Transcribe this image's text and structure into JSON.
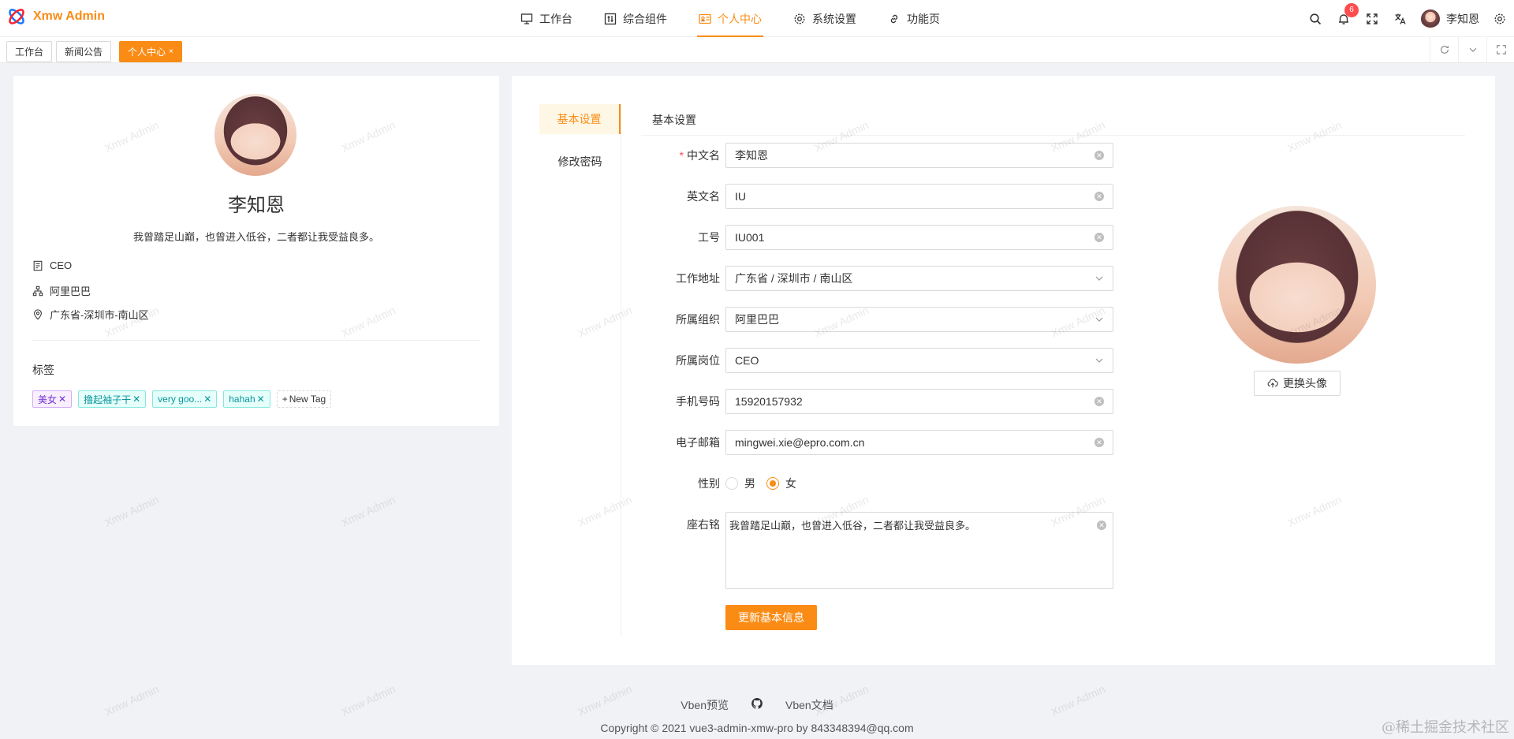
{
  "app": {
    "title": "Xmw Admin"
  },
  "topnav": [
    {
      "label": "工作台",
      "icon": "monitor-icon"
    },
    {
      "label": "综合组件",
      "icon": "component-icon"
    },
    {
      "label": "个人中心",
      "icon": "id-card-icon",
      "active": true
    },
    {
      "label": "系统设置",
      "icon": "gear-icon"
    },
    {
      "label": "功能页",
      "icon": "link-icon"
    }
  ],
  "header": {
    "notification_count": "6",
    "username": "李知恩"
  },
  "tabs": [
    {
      "label": "工作台"
    },
    {
      "label": "新闻公告"
    },
    {
      "label": "个人中心",
      "active": true,
      "close": "×"
    }
  ],
  "watermark": "Xmw Admin",
  "profile": {
    "name": "李知恩",
    "motto": "我曾踏足山巅，也曾进入低谷，二者都让我受益良多。",
    "position": "CEO",
    "organization": "阿里巴巴",
    "location": "广东省-深圳市-南山区",
    "tags_title": "标签",
    "tags": [
      "美女",
      "撸起袖子干",
      "very goo...",
      "hahah"
    ],
    "new_tag": "New Tag"
  },
  "settings": {
    "menu": [
      "基本设置",
      "修改密码"
    ],
    "section_title": "基本设置",
    "fields": {
      "cn_name": {
        "label": "中文名",
        "value": "李知恩",
        "required": true
      },
      "en_name": {
        "label": "英文名",
        "value": "IU"
      },
      "job_no": {
        "label": "工号",
        "value": "IU001"
      },
      "address": {
        "label": "工作地址",
        "value": "广东省 / 深圳市 / 南山区"
      },
      "org": {
        "label": "所属组织",
        "value": "阿里巴巴"
      },
      "post": {
        "label": "所属岗位",
        "value": "CEO"
      },
      "phone": {
        "label": "手机号码",
        "value": "15920157932"
      },
      "email": {
        "label": "电子邮箱",
        "value": "mingwei.xie@epro.com.cn"
      },
      "gender": {
        "label": "性别",
        "options": [
          "男",
          "女"
        ],
        "selected": "女"
      },
      "motto": {
        "label": "座右铭",
        "value": "我曾踏足山巅，也曾进入低谷，二者都让我受益良多。"
      }
    },
    "submit": "更新基本信息",
    "change_avatar": "更换头像"
  },
  "footer": {
    "links": [
      "Vben预览",
      "Vben文档"
    ],
    "copyright": "Copyright © 2021 vue3-admin-xmw-pro by 843348394@qq.com",
    "stamp": "@稀土掘金技术社区"
  },
  "colors": {
    "accent": "#fa8c16",
    "badge": "#ff4d4f"
  }
}
